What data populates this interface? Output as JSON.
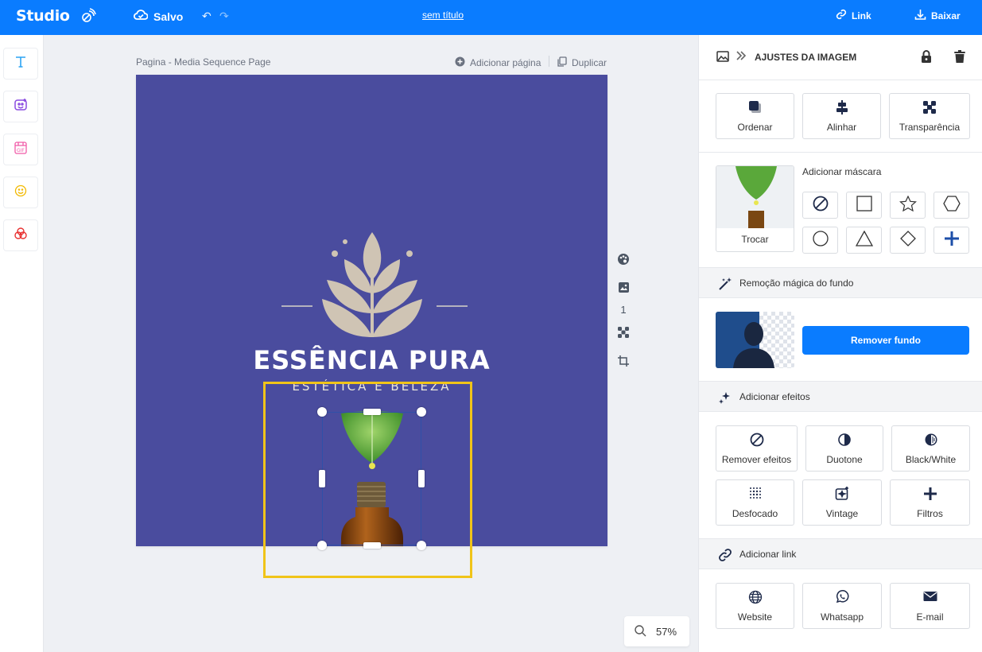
{
  "topbar": {
    "logo": "Studio",
    "saved_label": "Salvo",
    "document_title": "sem título",
    "link_label": "Link",
    "download_label": "Baixar"
  },
  "leftbar": {
    "items": [
      {
        "icon": "text-icon",
        "color": "#2ba4f4"
      },
      {
        "icon": "image-icon",
        "color": "#8a4be0"
      },
      {
        "icon": "gif-icon",
        "color": "#f05aa8"
      },
      {
        "icon": "emoji-icon",
        "color": "#f2b900"
      },
      {
        "icon": "color-circles-icon",
        "color": "#e83030"
      }
    ]
  },
  "canvas": {
    "page_label": "Pagina - Media Sequence Page",
    "add_page_label": "Adicionar página",
    "duplicate_label": "Duplicar",
    "background_color": "#4a4c9e",
    "brand_title": "ESSÊNCIA PURA",
    "brand_subtitle": "ESTÉTICA E BELEZA",
    "page_number": "1",
    "zoom_label": "57%"
  },
  "panel": {
    "header_title": "AJUSTES DA IMAGEM",
    "arrange_tiles": [
      {
        "label": "Ordenar",
        "icon": "layers-icon"
      },
      {
        "label": "Alinhar",
        "icon": "align-icon"
      },
      {
        "label": "Transparência",
        "icon": "transparency-icon"
      }
    ],
    "swap_label": "Trocar",
    "mask_title": "Adicionar máscara",
    "magic_title": "Remoção mágica do fundo",
    "remove_bg_label": "Remover fundo",
    "effects_title": "Adicionar efeitos",
    "effect_tiles": [
      {
        "label": "Remover efeitos",
        "icon": "no-effect-icon"
      },
      {
        "label": "Duotone",
        "icon": "duotone-icon"
      },
      {
        "label": "Black/White",
        "icon": "black-white-icon"
      },
      {
        "label": "Desfocado",
        "icon": "blur-icon"
      },
      {
        "label": "Vintage",
        "icon": "vintage-icon"
      },
      {
        "label": "Filtros",
        "icon": "plus-icon"
      }
    ],
    "link_title": "Adicionar link",
    "link_tiles": [
      {
        "label": "Website",
        "icon": "globe-icon"
      },
      {
        "label": "Whatsapp",
        "icon": "whatsapp-icon"
      },
      {
        "label": "E-mail",
        "icon": "mail-icon"
      }
    ],
    "accent_color": "#0a7cff"
  }
}
